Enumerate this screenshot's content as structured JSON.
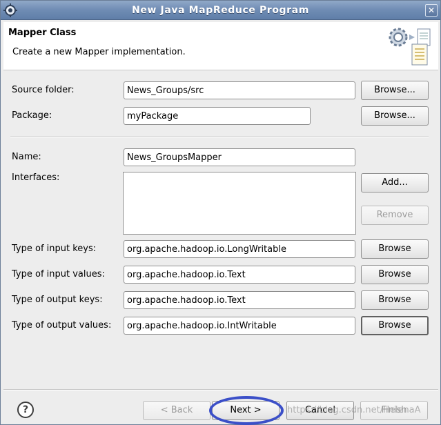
{
  "window": {
    "title": "New Java MapReduce Program",
    "close_label": "✕"
  },
  "header": {
    "title": "Mapper Class",
    "description": "Create a new Mapper implementation."
  },
  "form": {
    "source_folder_label": "Source folder:",
    "source_folder_value": "News_Groups/src",
    "source_browse_label": "Browse...",
    "package_label": "Package:",
    "package_value": "myPackage",
    "package_browse_label": "Browse...",
    "name_label": "Name:",
    "name_value": "News_GroupsMapper",
    "interfaces_label": "Interfaces:",
    "add_label": "Add...",
    "remove_label": "Remove",
    "input_keys_label": "Type of input keys:",
    "input_keys_value": "org.apache.hadoop.io.LongWritable",
    "input_values_label": "Type of input values:",
    "input_values_value": "org.apache.hadoop.io.Text",
    "output_keys_label": "Type of output keys:",
    "output_keys_value": "org.apache.hadoop.io.Text",
    "output_values_label": "Type of output values:",
    "output_values_value": "org.apache.hadoop.io.IntWritable",
    "browse_label": "Browse"
  },
  "footer": {
    "help_label": "?",
    "back_label": "< Back",
    "next_label": "Next >",
    "cancel_label": "Cancel",
    "finish_label": "Finish"
  },
  "watermark": "https://blog.csdn.net/HelenaA",
  "colors": {
    "titlebar": "#6f8cb4",
    "highlight_ellipse": "#3b4fc8"
  },
  "icons": {
    "title": "eclipse-gear-icon",
    "header": "gear-documents-icon",
    "help": "help-icon",
    "close": "close-icon"
  }
}
